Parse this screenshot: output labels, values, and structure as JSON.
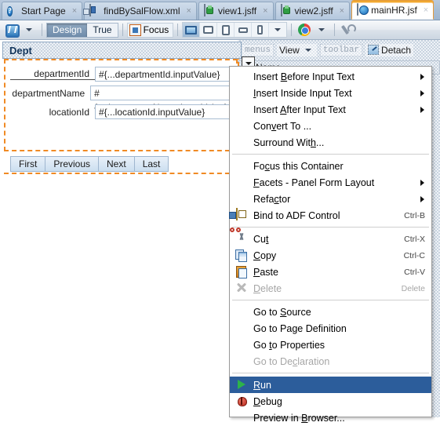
{
  "window": {
    "tabs": [
      {
        "label": "Start Page",
        "icon": "help-icon",
        "active": false,
        "closable": true
      },
      {
        "label": "findBySalFlow.xml",
        "icon": "xml-file-icon",
        "active": false,
        "closable": true
      },
      {
        "label": "view1.jsff",
        "icon": "jsff-file-icon",
        "active": false,
        "closable": true
      },
      {
        "label": "view2.jsff",
        "icon": "jsff-file-icon",
        "active": false,
        "closable": true
      },
      {
        "label": "mainHR.jsf",
        "icon": "jsf-globe-icon",
        "active": true,
        "closable": true
      }
    ],
    "close_glyph": "×"
  },
  "toolbar": {
    "refresh_icon": "refresh-icon",
    "view_mode": {
      "options": [
        "Design",
        "True"
      ],
      "selected": "Design"
    },
    "focus_label": "Focus",
    "devices": [
      {
        "name": "desktop",
        "selected": true
      },
      {
        "name": "tablet-landscape",
        "selected": false
      },
      {
        "name": "tablet-portrait",
        "selected": false
      },
      {
        "name": "mobile-landscape",
        "selected": false
      },
      {
        "name": "mobile-portrait",
        "selected": false
      }
    ],
    "browser_icon": "chrome-icon",
    "settings_icon": "wrench-icon"
  },
  "design": {
    "panel_title": "Dept",
    "form_fields": [
      {
        "label": "departmentId",
        "value": "#{...departmentId.inputValue}",
        "focused": true
      },
      {
        "label": "departmentName",
        "value": "#{...departmentName.inputValue}",
        "focused": false
      },
      {
        "label": "locationId",
        "value": "#{...locationId.inputValue}",
        "focused": false
      }
    ],
    "nav_buttons": [
      "First",
      "Previous",
      "Next",
      "Last"
    ],
    "panel_toolbar": {
      "menus_placeholder": "menus",
      "view_label": "View",
      "toolbar_placeholder": "toolbar",
      "detach_label": "Detach"
    },
    "column_header": "Name",
    "accent_color": "#f08a24",
    "selection_color": "#2c5d9b"
  },
  "context_menu": {
    "groups": [
      {
        "items": [
          {
            "label": "Insert Before Input Text",
            "mnemonic": "B",
            "submenu": true,
            "accel": "",
            "disabled": false,
            "icon": "",
            "selected": false
          },
          {
            "label": "Insert Inside Input Text",
            "mnemonic": "I",
            "submenu": true,
            "accel": "",
            "disabled": false,
            "icon": "",
            "selected": false
          },
          {
            "label": "Insert After Input Text",
            "mnemonic": "A",
            "submenu": true,
            "accel": "",
            "disabled": false,
            "icon": "",
            "selected": false
          },
          {
            "label": "Convert To ...",
            "mnemonic": "v",
            "submenu": false,
            "accel": "",
            "disabled": false,
            "icon": "",
            "selected": false
          },
          {
            "label": "Surround With...",
            "mnemonic": "h",
            "submenu": false,
            "accel": "",
            "disabled": false,
            "icon": "",
            "selected": false
          }
        ]
      },
      {
        "items": [
          {
            "label": "Focus this Container",
            "mnemonic": "c",
            "submenu": false,
            "accel": "",
            "disabled": false,
            "icon": "",
            "selected": false
          },
          {
            "label": "Facets - Panel Form Layout",
            "mnemonic": "F",
            "submenu": true,
            "accel": "",
            "disabled": false,
            "icon": "",
            "selected": false
          },
          {
            "label": "Refactor",
            "mnemonic": "c",
            "submenu": true,
            "accel": "",
            "disabled": false,
            "icon": "",
            "selected": false
          },
          {
            "label": "Bind to ADF Control",
            "mnemonic": "",
            "submenu": false,
            "accel": "Ctrl-B",
            "disabled": false,
            "icon": "bind-icon",
            "selected": false
          }
        ]
      },
      {
        "items": [
          {
            "label": "Cut",
            "mnemonic": "t",
            "submenu": false,
            "accel": "Ctrl-X",
            "disabled": false,
            "icon": "cut-icon",
            "selected": false
          },
          {
            "label": "Copy",
            "mnemonic": "C",
            "submenu": false,
            "accel": "Ctrl-C",
            "disabled": false,
            "icon": "copy-icon",
            "selected": false
          },
          {
            "label": "Paste",
            "mnemonic": "P",
            "submenu": false,
            "accel": "Ctrl-V",
            "disabled": false,
            "icon": "paste-icon",
            "selected": false
          },
          {
            "label": "Delete",
            "mnemonic": "D",
            "submenu": false,
            "accel": "Delete",
            "disabled": true,
            "icon": "delete-icon",
            "selected": false
          }
        ]
      },
      {
        "items": [
          {
            "label": "Go to Source",
            "mnemonic": "S",
            "submenu": false,
            "accel": "",
            "disabled": false,
            "icon": "",
            "selected": false
          },
          {
            "label": "Go to Page Definition",
            "mnemonic": "ag",
            "submenu": false,
            "accel": "",
            "disabled": false,
            "icon": "",
            "selected": false
          },
          {
            "label": "Go to Properties",
            "mnemonic": "t",
            "submenu": false,
            "accel": "",
            "disabled": false,
            "icon": "",
            "selected": false
          },
          {
            "label": "Go to Declaration",
            "mnemonic": "ec",
            "submenu": false,
            "accel": "",
            "disabled": true,
            "icon": "",
            "selected": false
          }
        ]
      },
      {
        "items": [
          {
            "label": "Run",
            "mnemonic": "R",
            "submenu": false,
            "accel": "",
            "disabled": false,
            "icon": "run-icon",
            "selected": true
          },
          {
            "label": "Debug",
            "mnemonic": "D",
            "submenu": false,
            "accel": "",
            "disabled": false,
            "icon": "debug-icon",
            "selected": false
          },
          {
            "label": "Preview in Browser...",
            "mnemonic": "B",
            "submenu": false,
            "accel": "",
            "disabled": false,
            "icon": "",
            "selected": false
          }
        ]
      }
    ]
  }
}
